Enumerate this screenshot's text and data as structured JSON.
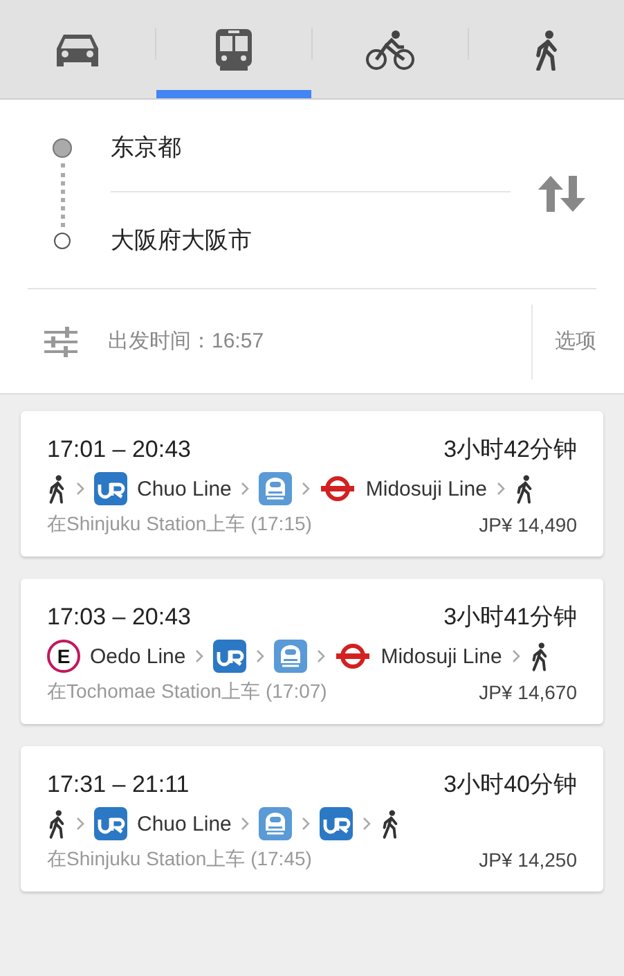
{
  "tabs": [
    {
      "kind": "car",
      "selected": false
    },
    {
      "kind": "transit",
      "selected": true
    },
    {
      "kind": "bike",
      "selected": false
    },
    {
      "kind": "walk",
      "selected": false
    }
  ],
  "origin": "东京都",
  "destination": "大阪府大阪市",
  "departure": "出发时间：16:57",
  "options": "选项",
  "routes": [
    {
      "times": "17:01 – 20:43",
      "duration": "3小时42分钟",
      "steps": [
        {
          "kind": "walk"
        },
        {
          "kind": "jr",
          "name": "Chuo Line"
        },
        {
          "kind": "shinkansen"
        },
        {
          "kind": "subway",
          "name": "Midosuji Line"
        },
        {
          "kind": "walk"
        }
      ],
      "boarding": "在Shinjuku Station上车 (17:15)",
      "fare": "JP¥ 14,490"
    },
    {
      "times": "17:03 – 20:43",
      "duration": "3小时41分钟",
      "steps": [
        {
          "kind": "oedo",
          "badge": "E",
          "name": "Oedo Line"
        },
        {
          "kind": "jr"
        },
        {
          "kind": "shinkansen"
        },
        {
          "kind": "subway",
          "name": "Midosuji Line"
        },
        {
          "kind": "walk"
        }
      ],
      "boarding": "在Tochomae Station上车 (17:07)",
      "fare": "JP¥ 14,670"
    },
    {
      "times": "17:31 – 21:11",
      "duration": "3小时40分钟",
      "steps": [
        {
          "kind": "walk"
        },
        {
          "kind": "jr",
          "name": "Chuo Line"
        },
        {
          "kind": "shinkansen"
        },
        {
          "kind": "jr"
        },
        {
          "kind": "walk"
        }
      ],
      "boarding": "在Shinjuku Station上车 (17:45)",
      "fare": "JP¥ 14,250"
    }
  ]
}
